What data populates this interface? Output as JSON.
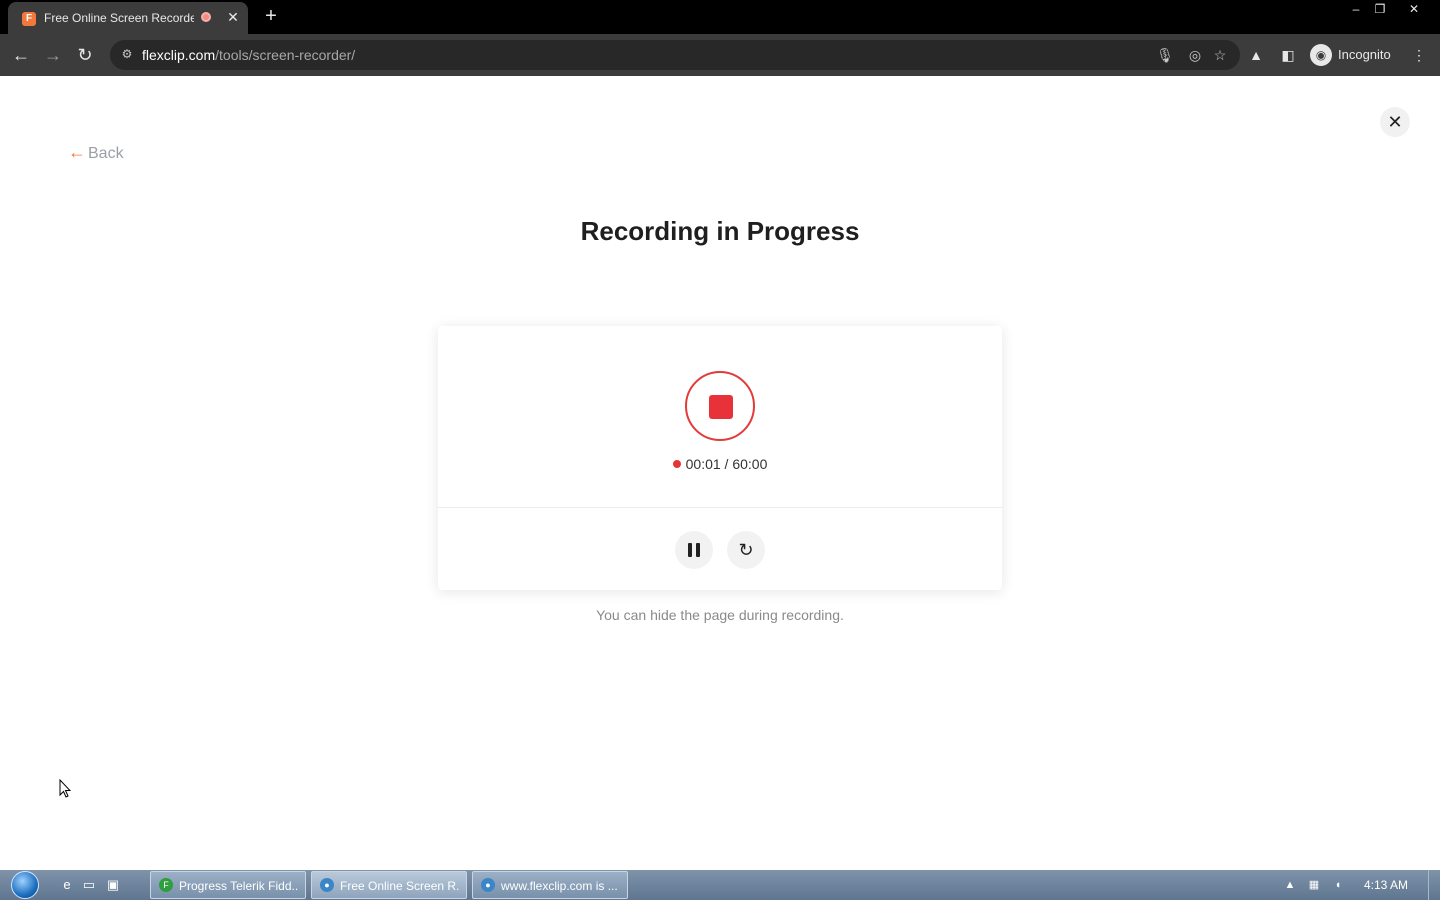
{
  "browser": {
    "tab_title": "Free Online Screen Recorder",
    "favicon_letter": "F",
    "tab_close": "✕",
    "new_tab": "+",
    "url_host": "flexclip.com",
    "url_path": "/tools/screen-recorder/",
    "incognito_label": "Incognito",
    "window_controls": {
      "minimize": "–",
      "restore": "❐",
      "close": "✕"
    },
    "nav": {
      "back": "←",
      "forward": "→",
      "reload": "↻"
    }
  },
  "page": {
    "back_label": "Back",
    "back_arrow": "←",
    "close_glyph": "✕",
    "title": "Recording in Progress",
    "timer_text": "00:01 / 60:00",
    "hint": "You can hide the page during recording.",
    "reset_glyph": "↻"
  },
  "taskbar": {
    "items": [
      {
        "label": "Progress Telerik Fidd...",
        "icon_color": "#2e9e3e"
      },
      {
        "label": "Free Online Screen R...",
        "icon_color": "#3a86c8"
      },
      {
        "label": "www.flexclip.com is ...",
        "icon_color": "#3a86c8"
      }
    ],
    "clock": "4:13 AM"
  },
  "colors": {
    "accent_orange": "#f2783b",
    "record_red": "#e8323a"
  }
}
